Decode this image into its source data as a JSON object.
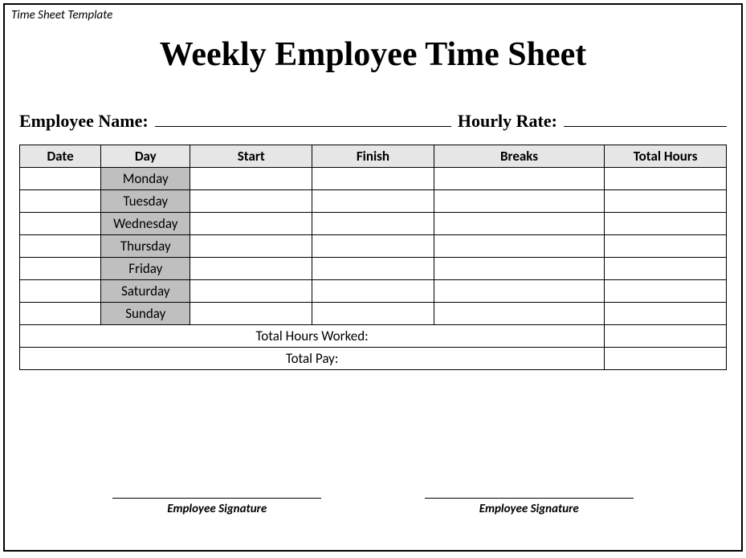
{
  "template_label": "Time Sheet Template",
  "title": "Weekly Employee Time Sheet",
  "fields": {
    "employee_name_label": "Employee Name:",
    "hourly_rate_label": "Hourly Rate:"
  },
  "table": {
    "headers": {
      "date": "Date",
      "day": "Day",
      "start": "Start",
      "finish": "Finish",
      "breaks": "Breaks",
      "total_hours": "Total Hours"
    },
    "rows": [
      {
        "date": "",
        "day": "Monday",
        "start": "",
        "finish": "",
        "breaks": "",
        "total_hours": ""
      },
      {
        "date": "",
        "day": "Tuesday",
        "start": "",
        "finish": "",
        "breaks": "",
        "total_hours": ""
      },
      {
        "date": "",
        "day": "Wednesday",
        "start": "",
        "finish": "",
        "breaks": "",
        "total_hours": ""
      },
      {
        "date": "",
        "day": "Thursday",
        "start": "",
        "finish": "",
        "breaks": "",
        "total_hours": ""
      },
      {
        "date": "",
        "day": "Friday",
        "start": "",
        "finish": "",
        "breaks": "",
        "total_hours": ""
      },
      {
        "date": "",
        "day": "Saturday",
        "start": "",
        "finish": "",
        "breaks": "",
        "total_hours": ""
      },
      {
        "date": "",
        "day": "Sunday",
        "start": "",
        "finish": "",
        "breaks": "",
        "total_hours": ""
      }
    ],
    "totals": {
      "hours_label": "Total Hours Worked:",
      "hours_value": "",
      "pay_label": "Total Pay:",
      "pay_value": ""
    }
  },
  "signatures": {
    "left_label": "Employee Signature",
    "right_label": "Employee Signature"
  }
}
